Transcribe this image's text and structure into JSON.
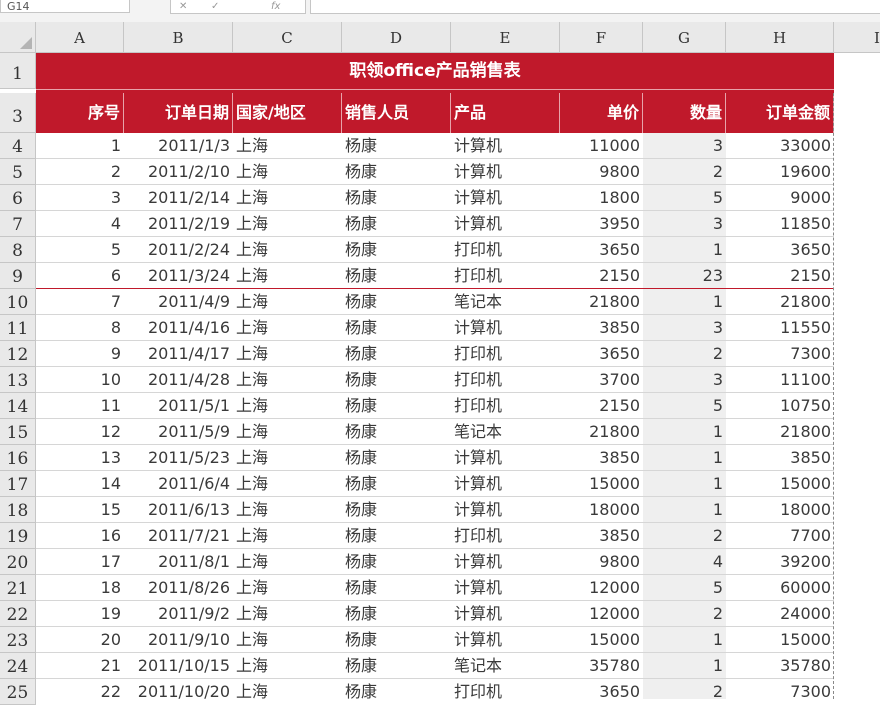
{
  "formula_bar": {
    "name_box": "G14",
    "fx_label": "fx",
    "formula": ""
  },
  "columns": [
    "A",
    "B",
    "C",
    "D",
    "E",
    "F",
    "G",
    "H",
    "I"
  ],
  "title": "职领office产品销售表",
  "headers": [
    "序号",
    "订单日期",
    "国家/地区",
    "销售人员",
    "产品",
    "单价",
    "数量",
    "订单金额"
  ],
  "row_numbers": [
    "1",
    "3",
    "4",
    "5",
    "6",
    "7",
    "8",
    "9",
    "10",
    "11",
    "12",
    "13",
    "14",
    "15",
    "16",
    "17",
    "18",
    "19",
    "20",
    "21",
    "22",
    "23",
    "24",
    "25"
  ],
  "rows": [
    [
      "1",
      "2011/1/3",
      "上海",
      "杨康",
      "计算机",
      "11000",
      "3",
      "33000"
    ],
    [
      "2",
      "2011/2/10",
      "上海",
      "杨康",
      "计算机",
      "9800",
      "2",
      "19600"
    ],
    [
      "3",
      "2011/2/14",
      "上海",
      "杨康",
      "计算机",
      "1800",
      "5",
      "9000"
    ],
    [
      "4",
      "2011/2/19",
      "上海",
      "杨康",
      "计算机",
      "3950",
      "3",
      "11850"
    ],
    [
      "5",
      "2011/2/24",
      "上海",
      "杨康",
      "打印机",
      "3650",
      "1",
      "3650"
    ],
    [
      "6",
      "2011/3/24",
      "上海",
      "杨康",
      "打印机",
      "2150",
      "23",
      "2150"
    ],
    [
      "7",
      "2011/4/9",
      "上海",
      "杨康",
      "笔记本",
      "21800",
      "1",
      "21800"
    ],
    [
      "8",
      "2011/4/16",
      "上海",
      "杨康",
      "计算机",
      "3850",
      "3",
      "11550"
    ],
    [
      "9",
      "2011/4/17",
      "上海",
      "杨康",
      "打印机",
      "3650",
      "2",
      "7300"
    ],
    [
      "10",
      "2011/4/28",
      "上海",
      "杨康",
      "打印机",
      "3700",
      "3",
      "11100"
    ],
    [
      "11",
      "2011/5/1",
      "上海",
      "杨康",
      "打印机",
      "2150",
      "5",
      "10750"
    ],
    [
      "12",
      "2011/5/9",
      "上海",
      "杨康",
      "笔记本",
      "21800",
      "1",
      "21800"
    ],
    [
      "13",
      "2011/5/23",
      "上海",
      "杨康",
      "计算机",
      "3850",
      "1",
      "3850"
    ],
    [
      "14",
      "2011/6/4",
      "上海",
      "杨康",
      "计算机",
      "15000",
      "1",
      "15000"
    ],
    [
      "15",
      "2011/6/13",
      "上海",
      "杨康",
      "计算机",
      "18000",
      "1",
      "18000"
    ],
    [
      "16",
      "2011/7/21",
      "上海",
      "杨康",
      "打印机",
      "3850",
      "2",
      "7700"
    ],
    [
      "17",
      "2011/8/1",
      "上海",
      "杨康",
      "计算机",
      "9800",
      "4",
      "39200"
    ],
    [
      "18",
      "2011/8/26",
      "上海",
      "杨康",
      "计算机",
      "12000",
      "5",
      "60000"
    ],
    [
      "19",
      "2011/9/2",
      "上海",
      "杨康",
      "计算机",
      "12000",
      "2",
      "24000"
    ],
    [
      "20",
      "2011/9/10",
      "上海",
      "杨康",
      "计算机",
      "15000",
      "1",
      "15000"
    ],
    [
      "21",
      "2011/10/15",
      "上海",
      "杨康",
      "笔记本",
      "35780",
      "1",
      "35780"
    ],
    [
      "22",
      "2011/10/20",
      "上海",
      "杨康",
      "打印机",
      "3650",
      "2",
      "7300"
    ]
  ],
  "colors": {
    "header_red": "#c0192b",
    "qty_fill": "#efefef"
  }
}
